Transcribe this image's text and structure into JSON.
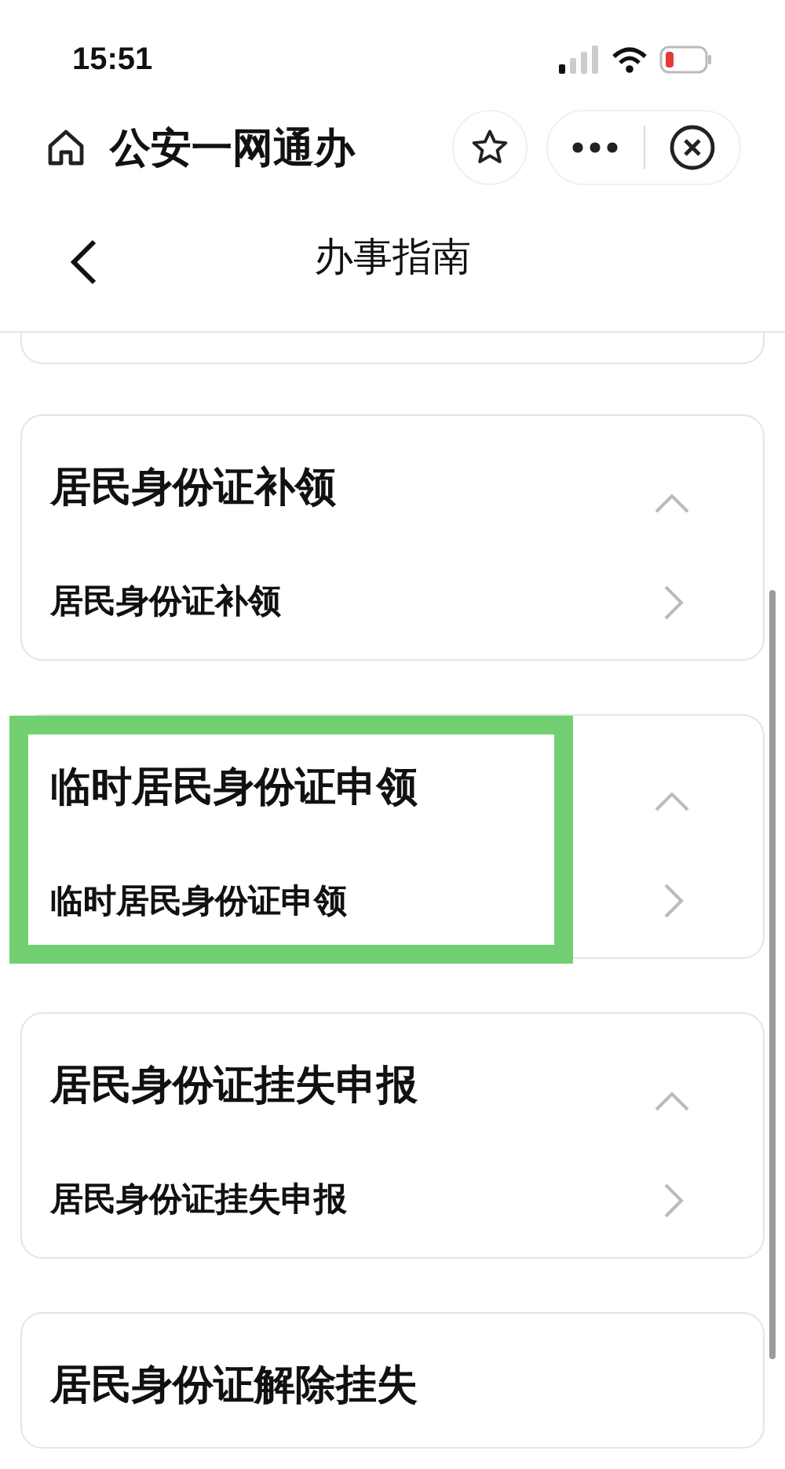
{
  "status_bar": {
    "time": "15:51"
  },
  "nav_bar": {
    "title": "公安一网通办"
  },
  "header": {
    "title": "办事指南"
  },
  "cards": [
    {
      "title": "居民身份证补领",
      "expanded": true,
      "items": [
        "居民身份证补领"
      ],
      "highlighted": false
    },
    {
      "title": "临时居民身份证申领",
      "expanded": true,
      "items": [
        "临时居民身份证申领"
      ],
      "highlighted": true
    },
    {
      "title": "居民身份证挂失申报",
      "expanded": true,
      "items": [
        "居民身份证挂失申报"
      ],
      "highlighted": false
    },
    {
      "title": "居民身份证解除挂失",
      "highlighted": false
    }
  ]
}
